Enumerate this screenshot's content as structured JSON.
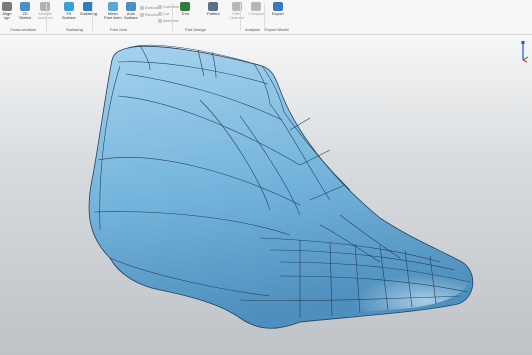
{
  "ribbon": {
    "tools": [
      {
        "id": "tool-1",
        "lines": [
          "Align",
          "ign"
        ],
        "color": "#7a7a7a",
        "disabled": false
      },
      {
        "id": "tool-2",
        "lines": [
          "2D",
          "Sketch"
        ],
        "color": "#4a90c8",
        "disabled": false
      },
      {
        "id": "tool-3",
        "lines": [
          "Multiple",
          "sections"
        ],
        "color": "#b0b0b0",
        "disabled": true
      },
      {
        "id": "tool-4",
        "lines": [
          "Fit",
          "Surface"
        ],
        "color": "#3aa0d8",
        "disabled": false
      },
      {
        "id": "tool-5",
        "lines": [
          "Surfacing",
          ""
        ],
        "color": "#2c7fc0",
        "disabled": false
      },
      {
        "id": "tool-6",
        "lines": [
          "Mesh",
          "Free-form"
        ],
        "color": "#5aa6d6",
        "disabled": false
      },
      {
        "id": "tool-7",
        "lines": [
          "Auto",
          "Surface"
        ],
        "color": "#4a8fc4",
        "disabled": false
      },
      {
        "id": "tool-8",
        "lines": [
          "Trim",
          ""
        ],
        "color": "#2f7d3a",
        "disabled": false
      },
      {
        "id": "tool-9",
        "lines": [
          "Pattern",
          ""
        ],
        "color": "#5a6f8c",
        "disabled": false
      },
      {
        "id": "tool-10",
        "lines": [
          "Fillet",
          "Chamfer"
        ],
        "color": "#b8b8b8",
        "disabled": true
      },
      {
        "id": "tool-11",
        "lines": [
          "Compare",
          ""
        ],
        "color": "#b8b8b8",
        "disabled": true
      },
      {
        "id": "tool-12",
        "lines": [
          "Export",
          ""
        ],
        "color": "#3a78c0",
        "disabled": false
      }
    ],
    "mini_tools": [
      {
        "id": "mini-1",
        "label": "Extrude",
        "color": "#c8c8c8"
      },
      {
        "id": "mini-2",
        "label": "Revolve",
        "color": "#c8c8c8"
      },
      {
        "id": "mini-3",
        "label": "Combine",
        "color": "#c8c8c8"
      },
      {
        "id": "mini-4",
        "label": "Cut",
        "color": "#c8c8c8"
      },
      {
        "id": "mini-5",
        "label": "Intersect",
        "color": "#c8c8c8"
      }
    ],
    "groups": [
      {
        "id": "group-1",
        "label": "Cross sections"
      },
      {
        "id": "group-2",
        "label": "Surfacing"
      },
      {
        "id": "group-3",
        "label": "Free form"
      },
      {
        "id": "group-4",
        "label": "Part Design"
      },
      {
        "id": "group-5",
        "label": "Analysis"
      },
      {
        "id": "group-6",
        "label": "Export Model"
      }
    ]
  },
  "model": {
    "fill_color": "#74b4dc",
    "shade_color": "#4e8fbd",
    "highlight_color": "#a6d3ee",
    "line_color": "#24425a"
  },
  "axis": {
    "x_color": "#d03030",
    "y_color": "#30a030",
    "z_color": "#3050d0"
  }
}
